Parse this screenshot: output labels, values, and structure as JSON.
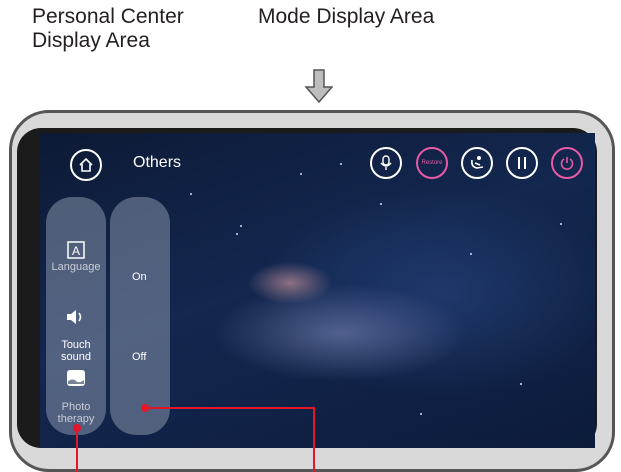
{
  "captions": {
    "personal": "Personal Center\nDisplay Area",
    "mode": "Mode Display Area"
  },
  "screen": {
    "title": "Others",
    "restore_label": "Restore"
  },
  "personal_center": {
    "items": [
      {
        "label": "Language",
        "icon": "language-icon"
      },
      {
        "label": "Touch\nsound",
        "icon": "speaker-icon"
      },
      {
        "label": "Photo\ntherapy",
        "icon": "photo-therapy-icon"
      }
    ]
  },
  "mode_display": {
    "options": [
      {
        "label": "On"
      },
      {
        "label": "Off"
      }
    ]
  },
  "top_icons": [
    "microphone-icon",
    "restore-icon",
    "massage-chair-icon",
    "pause-icon",
    "power-icon"
  ],
  "colors": {
    "accent_pink": "#e85aa6",
    "callout_red": "#e4162a"
  }
}
